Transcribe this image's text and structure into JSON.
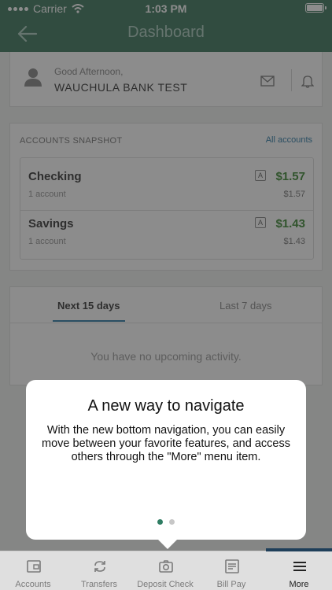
{
  "status_bar": {
    "carrier": "Carrier",
    "time": "1:03 PM"
  },
  "nav": {
    "title": "Dashboard"
  },
  "greeting": {
    "subtitle": "Good Afternoon,",
    "name": "WAUCHULA BANK TEST"
  },
  "snapshot": {
    "title": "ACCOUNTS SNAPSHOT",
    "link": "All accounts",
    "accounts": [
      {
        "name": "Checking",
        "count": "1 account",
        "balance": "$1.57",
        "available": "$1.57",
        "flag": "A"
      },
      {
        "name": "Savings",
        "count": "1 account",
        "balance": "$1.43",
        "available": "$1.43",
        "flag": "A"
      }
    ]
  },
  "activity": {
    "tabs": [
      {
        "label": "Next 15 days"
      },
      {
        "label": "Last 7 days"
      }
    ],
    "empty_message": "You have no upcoming activity."
  },
  "popup": {
    "title": "A new way to navigate",
    "body": "With the new bottom navigation, you can easily move between your favorite features, and access others through the \"More\" menu item.",
    "pages": 2,
    "current_page": 1
  },
  "tabbar": {
    "items": [
      {
        "label": "Accounts",
        "icon": "wallet-icon"
      },
      {
        "label": "Transfers",
        "icon": "transfer-icon"
      },
      {
        "label": "Deposit Check",
        "icon": "camera-icon"
      },
      {
        "label": "Bill Pay",
        "icon": "bill-icon"
      },
      {
        "label": "More",
        "icon": "menu-icon"
      }
    ]
  },
  "colors": {
    "header": "#5a8a76",
    "accent": "#4d8fb3",
    "positive": "#5a9a52",
    "pager_active": "#2f7d63",
    "tab_indicator": "#1f3f5a"
  }
}
